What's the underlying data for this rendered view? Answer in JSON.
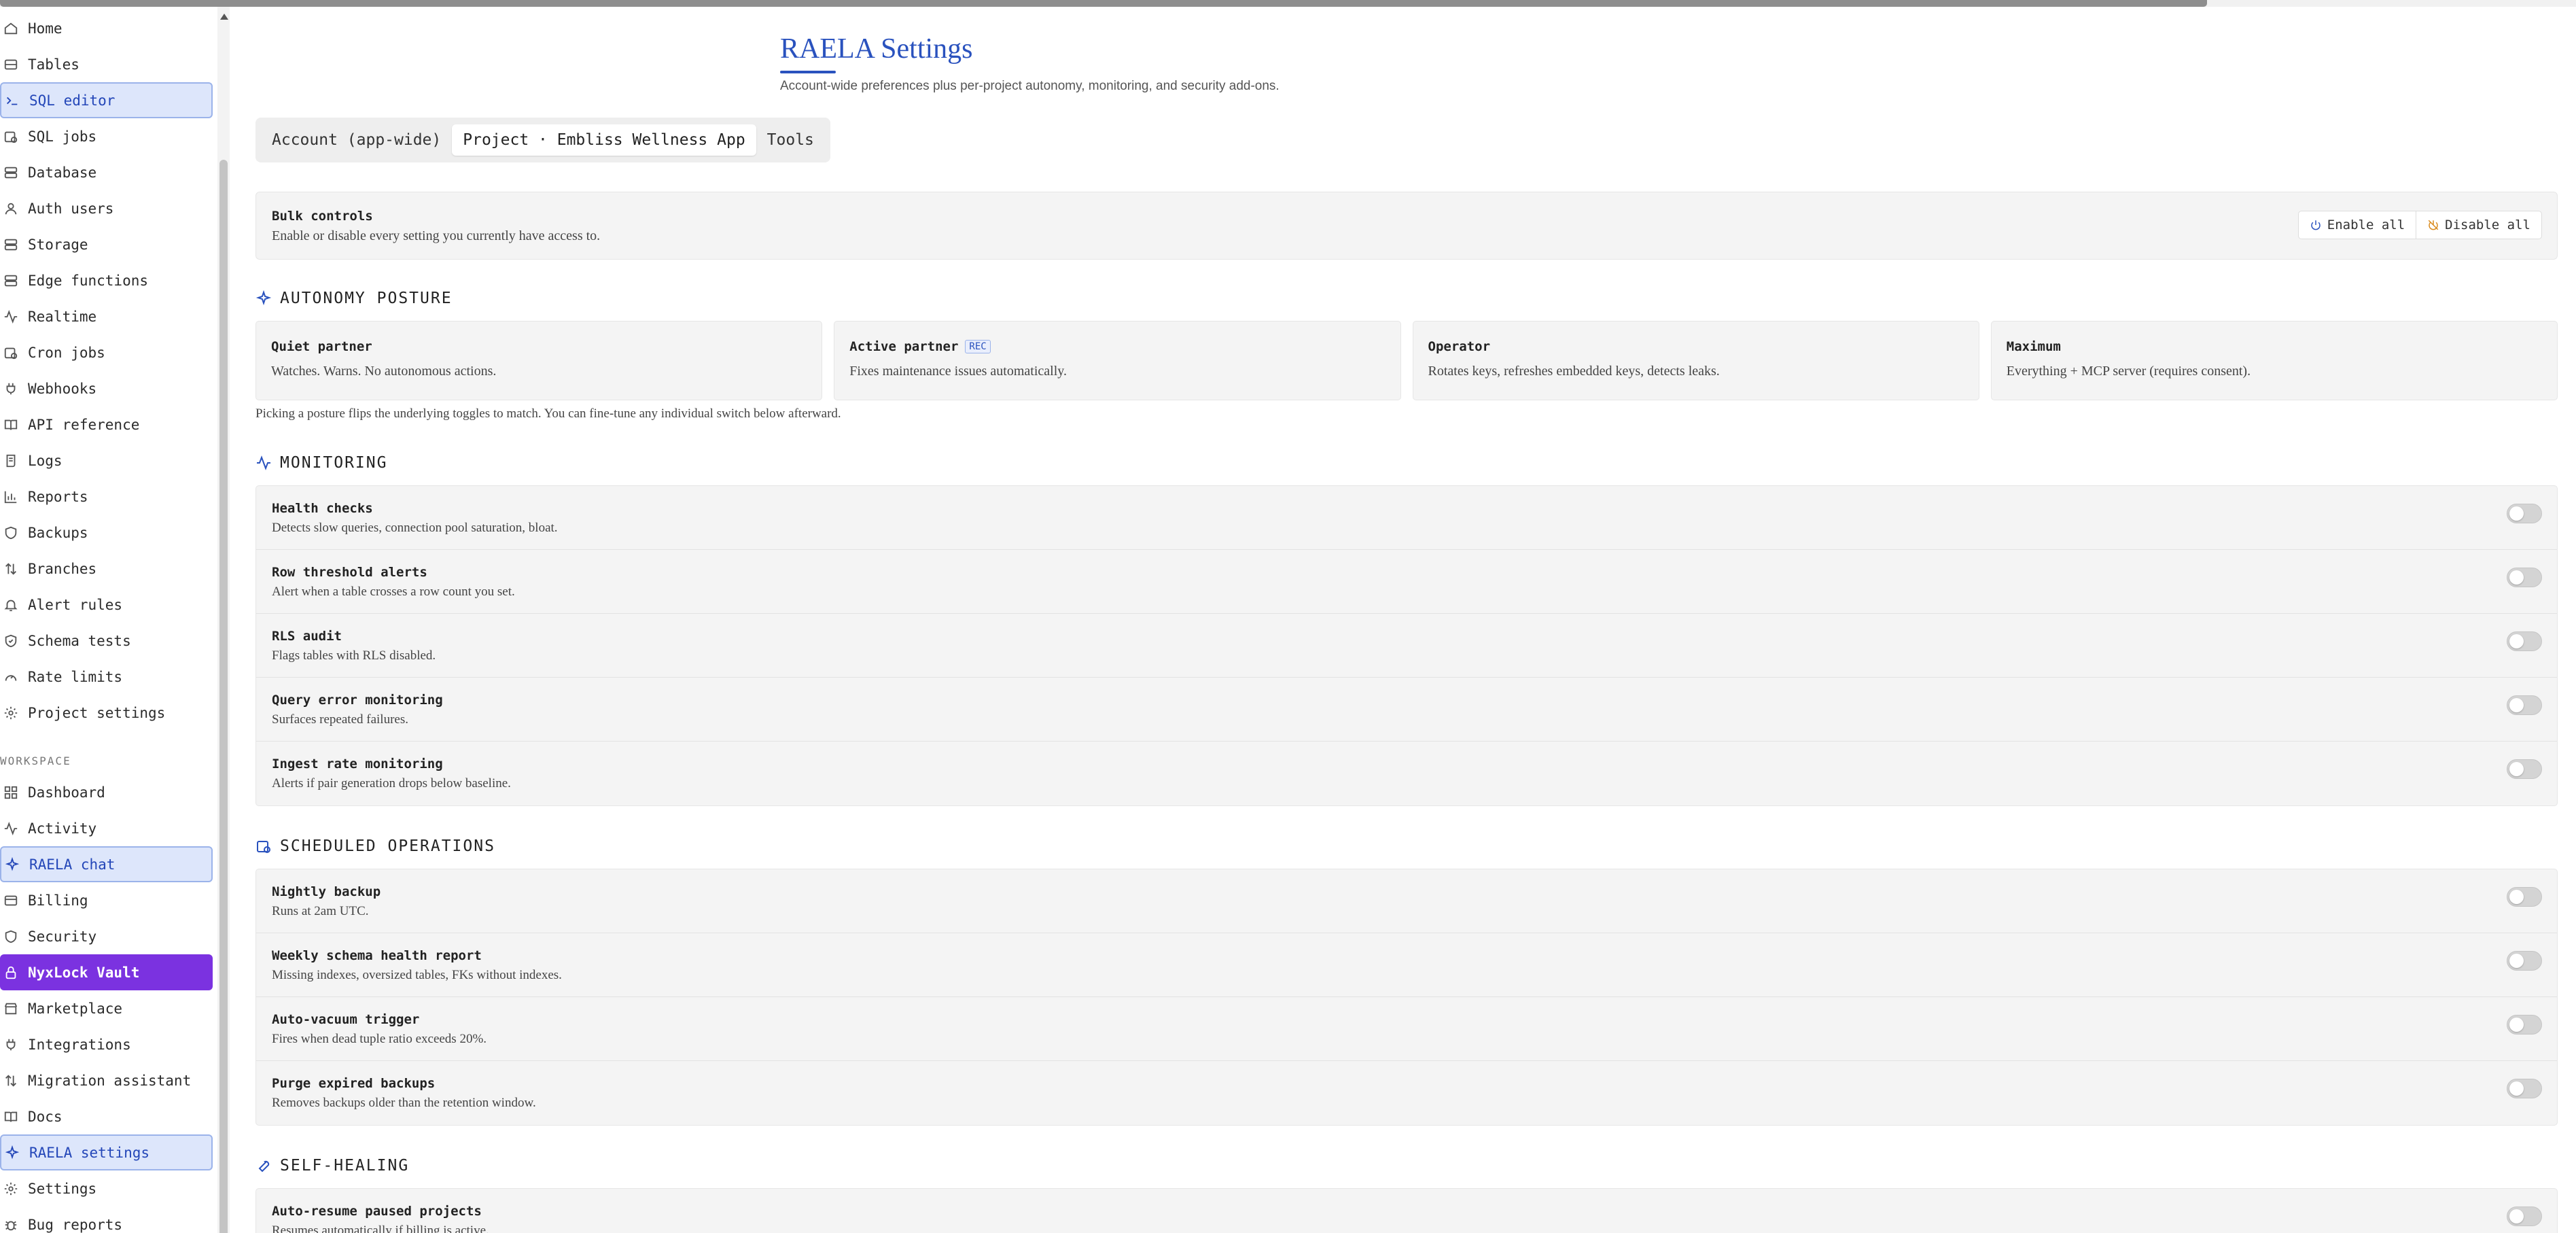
{
  "sidebar": {
    "items": [
      {
        "label": "Home",
        "icon": "home-icon"
      },
      {
        "label": "Tables",
        "icon": "table-icon"
      },
      {
        "label": "SQL editor",
        "icon": "terminal-icon"
      },
      {
        "label": "SQL jobs",
        "icon": "calendar-clock-icon"
      },
      {
        "label": "Database",
        "icon": "database-icon"
      },
      {
        "label": "Auth users",
        "icon": "user-icon"
      },
      {
        "label": "Storage",
        "icon": "storage-icon"
      },
      {
        "label": "Edge functions",
        "icon": "server-icon"
      },
      {
        "label": "Realtime",
        "icon": "activity-icon"
      },
      {
        "label": "Cron jobs",
        "icon": "calendar-clock-icon"
      },
      {
        "label": "Webhooks",
        "icon": "plug-icon"
      },
      {
        "label": "API reference",
        "icon": "book-icon"
      },
      {
        "label": "Logs",
        "icon": "scroll-icon"
      },
      {
        "label": "Reports",
        "icon": "bar-chart-icon"
      },
      {
        "label": "Backups",
        "icon": "shield-icon"
      },
      {
        "label": "Branches",
        "icon": "arrows-up-down-icon"
      },
      {
        "label": "Alert rules",
        "icon": "bell-icon"
      },
      {
        "label": "Schema tests",
        "icon": "shield-check-icon"
      },
      {
        "label": "Rate limits",
        "icon": "gauge-icon"
      },
      {
        "label": "Project settings",
        "icon": "gear-icon"
      }
    ],
    "section_label": "WORKSPACE",
    "workspace_items": [
      {
        "label": "Dashboard",
        "icon": "grid-icon"
      },
      {
        "label": "Activity",
        "icon": "activity-icon"
      },
      {
        "label": "RAELA chat",
        "icon": "sparkle-icon"
      },
      {
        "label": "Billing",
        "icon": "credit-card-icon"
      },
      {
        "label": "Security",
        "icon": "shield-icon"
      },
      {
        "label": "NyxLock Vault",
        "icon": "lock-icon"
      },
      {
        "label": "Marketplace",
        "icon": "store-icon"
      },
      {
        "label": "Integrations",
        "icon": "plug-icon"
      },
      {
        "label": "Migration assistant",
        "icon": "arrows-up-down-icon"
      },
      {
        "label": "Docs",
        "icon": "book-icon"
      },
      {
        "label": "RAELA settings",
        "icon": "sparkle-icon"
      },
      {
        "label": "Settings",
        "icon": "gear-icon"
      },
      {
        "label": "Bug reports",
        "icon": "bug-icon"
      }
    ]
  },
  "header": {
    "title": "RAELA Settings",
    "subtitle": "Account-wide preferences plus per-project autonomy, monitoring, and security add-ons."
  },
  "tabs": [
    {
      "label": "Account (app-wide)"
    },
    {
      "label": "Project · Embliss Wellness App"
    },
    {
      "label": "Tools"
    }
  ],
  "bulk": {
    "label": "Bulk controls",
    "description": "Enable or disable every setting you currently have access to.",
    "enable_label": "Enable all",
    "disable_label": "Disable all"
  },
  "autonomy": {
    "heading": "AUTONOMY POSTURE",
    "postures": [
      {
        "name": "Quiet partner",
        "desc": "Watches. Warns. No autonomous actions."
      },
      {
        "name": "Active partner",
        "badge": "REC",
        "desc": "Fixes maintenance issues automatically."
      },
      {
        "name": "Operator",
        "desc": "Rotates keys, refreshes embedded keys, detects leaks."
      },
      {
        "name": "Maximum",
        "desc": "Everything + MCP server (requires consent)."
      }
    ],
    "note": "Picking a posture flips the underlying toggles to match. You can fine-tune any individual switch below afterward."
  },
  "monitoring": {
    "heading": "MONITORING",
    "rows": [
      {
        "name": "Health checks",
        "desc": "Detects slow queries, connection pool saturation, bloat."
      },
      {
        "name": "Row threshold alerts",
        "desc": "Alert when a table crosses a row count you set."
      },
      {
        "name": "RLS audit",
        "desc": "Flags tables with RLS disabled."
      },
      {
        "name": "Query error monitoring",
        "desc": "Surfaces repeated failures."
      },
      {
        "name": "Ingest rate monitoring",
        "desc": "Alerts if pair generation drops below baseline."
      }
    ]
  },
  "scheduled": {
    "heading": "SCHEDULED OPERATIONS",
    "rows": [
      {
        "name": "Nightly backup",
        "desc": "Runs at 2am UTC."
      },
      {
        "name": "Weekly schema health report",
        "desc": "Missing indexes, oversized tables, FKs without indexes."
      },
      {
        "name": "Auto-vacuum trigger",
        "desc": "Fires when dead tuple ratio exceeds 20%."
      },
      {
        "name": "Purge expired backups",
        "desc": "Removes backups older than the retention window."
      }
    ]
  },
  "self_healing": {
    "heading": "SELF-HEALING",
    "rows": [
      {
        "name": "Auto-resume paused projects",
        "desc": "Resumes automatically if billing is active."
      }
    ]
  },
  "colors": {
    "accent": "#2a52be",
    "active_bg": "#dde6fb",
    "vault_purple": "#7b32e0",
    "card_bg": "#f4f4f4"
  }
}
